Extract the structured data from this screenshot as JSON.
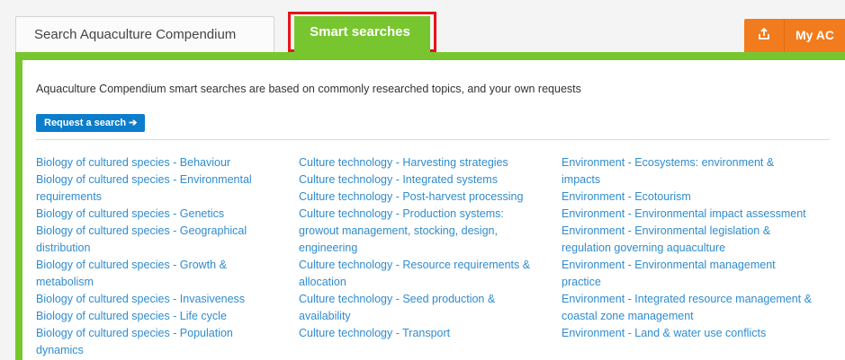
{
  "tabs": {
    "search_label": "Search Aquaculture Compendium",
    "smart_label": "Smart searches"
  },
  "header_actions": {
    "share_icon": "share-icon",
    "my_ac_label": "My AC"
  },
  "intro_text": "Aquaculture Compendium smart searches are based on commonly researched topics, and your own requests",
  "request_button_label": "Request a search ➔",
  "columns": [
    [
      "Biology of cultured species - Behaviour",
      "Biology of cultured species - Environmental requirements",
      "Biology of cultured species - Genetics",
      "Biology of cultured species - Geographical distribution",
      "Biology of cultured species - Growth & metabolism",
      "Biology of cultured species - Invasiveness",
      "Biology of cultured species - Life cycle",
      "Biology of cultured species - Population dynamics"
    ],
    [
      "Culture technology - Harvesting strategies",
      "Culture technology - Integrated systems",
      "Culture technology - Post-harvest processing",
      "Culture technology - Production systems: growout management, stocking, design, engineering",
      "Culture technology - Resource requirements & allocation",
      "Culture technology - Seed production & availability",
      "Culture technology - Transport"
    ],
    [
      "Environment - Ecosystems: environment & impacts",
      "Environment - Ecotourism",
      "Environment - Environmental impact assessment",
      "Environment - Environmental legislation & regulation governing aquaculture",
      "Environment - Environmental management practice",
      "Environment - Integrated resource management & coastal zone management",
      "Environment - Land & water use conflicts"
    ]
  ],
  "colors": {
    "tab_active_bg": "#78c62f",
    "highlight_border": "#e8131a",
    "action_button_bg": "#f27b1e",
    "request_button_bg": "#0b7dcb",
    "link_color": "#2f8ccf"
  }
}
